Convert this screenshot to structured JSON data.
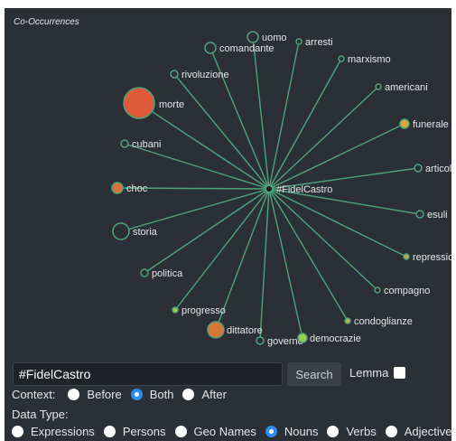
{
  "panel_title": "Co-Occurrences",
  "graph": {
    "center": {
      "label": "#FidelCastro"
    },
    "edge_color": "#4fa37a",
    "nodes": [
      {
        "label": "uomo",
        "color": "#2b3036"
      },
      {
        "label": "comandante",
        "color": "#2b3036"
      },
      {
        "label": "arresti",
        "color": "#2b3036"
      },
      {
        "label": "marxismo",
        "color": "#2b3036"
      },
      {
        "label": "rivoluzione",
        "color": "#2b3036"
      },
      {
        "label": "americani",
        "color": "#2b3036"
      },
      {
        "label": "morte",
        "color": "#e05a3a"
      },
      {
        "label": "funerale",
        "color": "#d9a83a"
      },
      {
        "label": "cubani",
        "color": "#2b3036"
      },
      {
        "label": "articolo",
        "color": "#2b3036"
      },
      {
        "label": "choc",
        "color": "#d9763a"
      },
      {
        "label": "esuli",
        "color": "#2b3036"
      },
      {
        "label": "storia",
        "color": "#2b3036"
      },
      {
        "label": "repressioni",
        "color": "#b7b04a"
      },
      {
        "label": "politica",
        "color": "#2b3036"
      },
      {
        "label": "compagno",
        "color": "#2b3036"
      },
      {
        "label": "progresso",
        "color": "#9ccc4a"
      },
      {
        "label": "condoglianze",
        "color": "#b7b04a"
      },
      {
        "label": "dittatore",
        "color": "#d9763a"
      },
      {
        "label": "governo",
        "color": "#2b3036"
      },
      {
        "label": "democrazie",
        "color": "#9ccc4a"
      }
    ]
  },
  "search": {
    "value": "#FidelCastro",
    "button_label": "Search",
    "lemma_label": "Lemma",
    "lemma_checked": false
  },
  "context": {
    "label": "Context:",
    "options": [
      "Before",
      "Both",
      "After"
    ],
    "selected": "Both"
  },
  "data_type": {
    "label": "Data Type:",
    "options": [
      "Expressions",
      "Persons",
      "Geo Names",
      "Nouns",
      "Verbs",
      "Adjectives"
    ],
    "selected": "Nouns"
  }
}
